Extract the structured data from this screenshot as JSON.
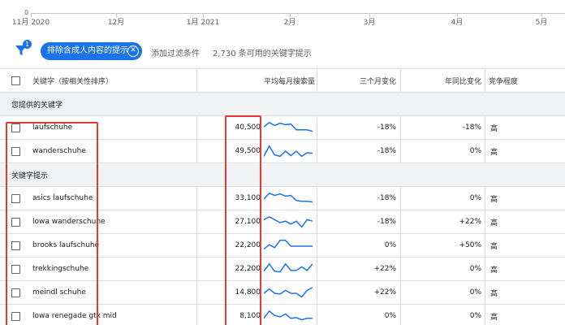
{
  "axis": {
    "zero": "0",
    "labels": [
      "11月 2020",
      "12月",
      "1月 2021",
      "2月",
      "3月",
      "4月",
      "5月"
    ]
  },
  "filterbar": {
    "badge": "1",
    "chip_label": "排除含成人内容的提示",
    "add_filter": "添加过滤条件",
    "available": "2,730 条可用的关键字提示"
  },
  "table": {
    "headers": {
      "keyword": "关键字（按相关性排序）",
      "volume": "平均每月搜索量",
      "three_month": "三个月变化",
      "yoy": "年同比变化",
      "competition": "竞争程度"
    },
    "group_provided": "您提供的关键字",
    "group_suggestions": "关键字提示",
    "provided": [
      {
        "keyword": "laufschuhe",
        "volume": "40,500",
        "three_month": "-18%",
        "yoy": "-18%",
        "competition": "高",
        "trend": [
          60,
          90,
          70,
          85,
          75,
          80,
          40,
          40,
          40,
          30
        ]
      },
      {
        "keyword": "wanderschuhe",
        "volume": "49,500",
        "three_month": "-18%",
        "yoy": "0%",
        "competition": "高",
        "trend": [
          20,
          90,
          30,
          20,
          55,
          25,
          55,
          20,
          45,
          40
        ]
      }
    ],
    "suggestions": [
      {
        "keyword": "asics laufschuhe",
        "volume": "33,100",
        "three_month": "-18%",
        "yoy": "0%",
        "competition": "高",
        "trend": [
          50,
          90,
          75,
          85,
          70,
          75,
          40,
          35,
          35,
          30
        ]
      },
      {
        "keyword": "lowa wanderschuhe",
        "volume": "27,100",
        "three_month": "-18%",
        "yoy": "+22%",
        "competition": "高",
        "trend": [
          70,
          90,
          70,
          50,
          60,
          40,
          60,
          20,
          70,
          60
        ]
      },
      {
        "keyword": "brooks laufschuhe",
        "volume": "22,200",
        "three_month": "0%",
        "yoy": "+50%",
        "competition": "高",
        "trend": [
          30,
          60,
          40,
          90,
          90,
          50,
          50,
          50,
          50,
          50
        ]
      },
      {
        "keyword": "trekkingschuhe",
        "volume": "22,200",
        "three_month": "+22%",
        "yoy": "0%",
        "competition": "高",
        "trend": [
          40,
          90,
          40,
          35,
          90,
          45,
          45,
          70,
          45,
          90
        ]
      },
      {
        "keyword": "meindl schuhe",
        "volume": "14,800",
        "three_month": "+22%",
        "yoy": "0%",
        "competition": "高",
        "trend": [
          50,
          80,
          50,
          45,
          70,
          50,
          50,
          25,
          70,
          90
        ]
      },
      {
        "keyword": "lowa renegade gtx mid",
        "volume": "8,100",
        "three_month": "0%",
        "yoy": "0%",
        "competition": "高",
        "trend": [
          40,
          90,
          60,
          50,
          70,
          40,
          45,
          30,
          40,
          40
        ]
      }
    ]
  },
  "colors": {
    "accent": "#1a73e8",
    "highlight": "#e53935",
    "group_bg": "#f1f3f4"
  }
}
